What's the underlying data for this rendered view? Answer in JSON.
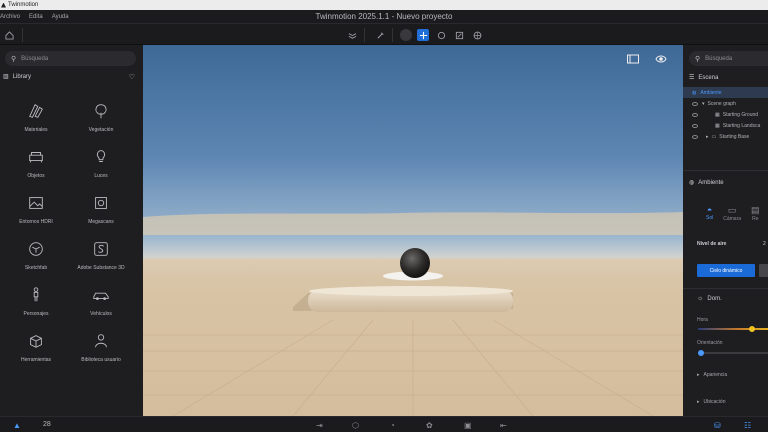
{
  "app": {
    "name": "Twinmotion"
  },
  "menu": [
    "Archivo",
    "Edita",
    "Ayuda"
  ],
  "project_title": "Twinmotion 2025.1.1 - Nuevo proyecto",
  "left_panel": {
    "search_placeholder": "Búsqueda",
    "section_title": "Library",
    "items": [
      {
        "label": "Materiales",
        "icon": "materials-icon"
      },
      {
        "label": "Vegetación",
        "icon": "vegetation-icon"
      },
      {
        "label": "Objetos",
        "icon": "objects-icon"
      },
      {
        "label": "Luces",
        "icon": "lights-icon"
      },
      {
        "label": "Entornos HDRI",
        "icon": "hdri-icon"
      },
      {
        "label": "Megascans",
        "icon": "megascans-icon"
      },
      {
        "label": "Sketchfab",
        "icon": "sketchfab-icon"
      },
      {
        "label": "Adobe Substance 3D",
        "icon": "substance-icon"
      },
      {
        "label": "Personajes",
        "icon": "characters-icon"
      },
      {
        "label": "Vehículos",
        "icon": "vehicles-icon"
      },
      {
        "label": "Herramientas",
        "icon": "tools-icon"
      },
      {
        "label": "Biblioteca usuario",
        "icon": "user-library-icon"
      }
    ]
  },
  "right_panel": {
    "search_placeholder": "Búsqueda",
    "scene_title": "Escena",
    "tree": [
      {
        "label": "Ambiente"
      },
      {
        "label": "Scene graph"
      },
      {
        "label": "Starting Ground"
      },
      {
        "label": "Starting Landsca"
      },
      {
        "label": "Starting Base"
      }
    ],
    "env_title": "Ambiente",
    "tabs": [
      "Sol",
      "Cámara",
      "Re"
    ],
    "sky_label": "Nivel de aire",
    "sky_value": "2",
    "dynamic_sky_button": "Cielo dinámico",
    "sun_label": "Dom.",
    "hour_label": "Hora",
    "hour_value": 0.68,
    "orientation_label": "Orientación",
    "orientation_value": 0.04,
    "appearance_label": "Apariencia",
    "location_label": "Ubicación"
  },
  "status": {
    "fps": "28"
  }
}
